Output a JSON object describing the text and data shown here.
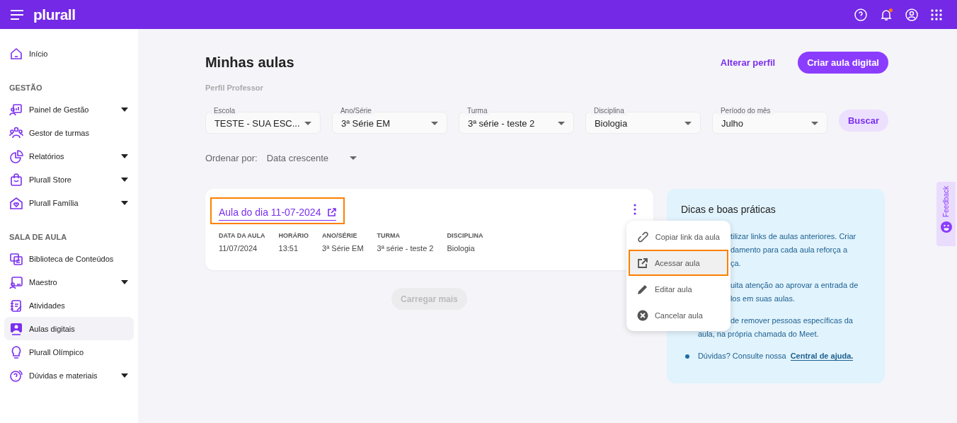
{
  "topbar": {
    "logo": "plurall",
    "notification_dot": true
  },
  "sidebar": {
    "sections": [
      {
        "items": [
          {
            "label": "Início",
            "expandable": false,
            "selected": false
          }
        ]
      },
      {
        "title": "GESTÃO",
        "items": [
          {
            "label": "Painel de Gestão",
            "expandable": true,
            "selected": false
          },
          {
            "label": "Gestor de turmas",
            "expandable": false,
            "selected": false
          },
          {
            "label": "Relatórios",
            "expandable": true,
            "selected": false
          },
          {
            "label": "Plurall Store",
            "expandable": true,
            "selected": false
          },
          {
            "label": "Plurall Família",
            "expandable": true,
            "selected": false
          }
        ]
      },
      {
        "title": "SALA DE AULA",
        "items": [
          {
            "label": "Biblioteca de Conteúdos",
            "expandable": false,
            "selected": false
          },
          {
            "label": "Maestro",
            "expandable": true,
            "selected": false
          },
          {
            "label": "Atividades",
            "expandable": false,
            "selected": false
          },
          {
            "label": "Aulas digitais",
            "expandable": false,
            "selected": true
          },
          {
            "label": "Plurall Olímpico",
            "expandable": false,
            "selected": false
          },
          {
            "label": "Dúvidas e materiais",
            "expandable": true,
            "selected": false
          }
        ]
      }
    ]
  },
  "header": {
    "title": "Minhas aulas",
    "subtitle": "Perfil Professor",
    "link": "Alterar perfil",
    "primary_button": "Criar aula digital"
  },
  "filters": [
    {
      "label": "Escola",
      "value": "TESTE - SUA ESC..."
    },
    {
      "label": "Ano/Série",
      "value": "3ª Série EM"
    },
    {
      "label": "Turma",
      "value": "3ª série - teste 2"
    },
    {
      "label": "Disciplina",
      "value": "Biologia"
    },
    {
      "label": "Período do mês",
      "value": "Julho"
    }
  ],
  "search_button": "Buscar",
  "sort": {
    "label": "Ordenar por:",
    "value": "Data crescente"
  },
  "lesson": {
    "title": "Aula do dia 11-07-2024",
    "highlighted": true,
    "fields": [
      {
        "label": "DATA DA AULA",
        "value": "11/07/2024"
      },
      {
        "label": "HORÁRIO",
        "value": "13:51"
      },
      {
        "label": "ANO/SÉRIE",
        "value": "3ª Série EM"
      },
      {
        "label": "TURMA",
        "value": "3ª série - teste 2"
      },
      {
        "label": "DISCIPLINA",
        "value": "Biologia"
      }
    ]
  },
  "load_more": {
    "label": "Carregar mais",
    "disabled": true
  },
  "menu": [
    {
      "label": "Copiar link da aula",
      "selected": false
    },
    {
      "label": "Acessar aula",
      "selected": true
    },
    {
      "label": "Editar aula",
      "selected": false
    },
    {
      "label": "Cancelar aula",
      "selected": false
    }
  ],
  "tips": {
    "title": "Dicas e boas práticas",
    "items": [
      {
        "lines": [
          {
            "text": "tilizar links de aulas anteriores. Criar",
            "covered": true
          },
          {
            "text": "damento para cada aula reforça a",
            "covered": true
          },
          {
            "text": "ça.",
            "covered": true
          }
        ]
      },
      {
        "lines": [
          {
            "text": "uita atenção ao aprovar a entrada de",
            "covered": true
          },
          {
            "text": "los em suas aulas.",
            "covered": true
          }
        ]
      },
      {
        "lines": [
          {
            "text": "de remover pessoas específicas da",
            "covered": true
          },
          {
            "text": "aula, na própria chamada do Meet."
          }
        ]
      },
      {
        "lines": [
          {
            "text": "Dúvidas? Consulte nossa"
          }
        ],
        "link": "Central de ajuda."
      }
    ]
  },
  "feedback": "Feedback"
}
